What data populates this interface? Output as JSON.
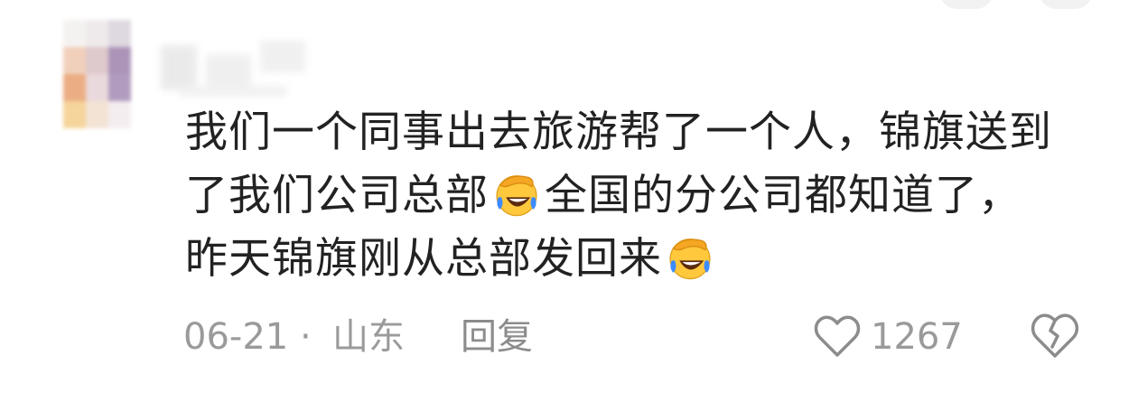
{
  "comment": {
    "line1": "我们一个同事出去旅游帮了一个人，锦旗送到",
    "line2_a": "了我们公司总部",
    "line2_b": "全国的分公司都知道了，",
    "line3_a": "昨天锦旗刚从总部发回来",
    "emoji_1": "facepalm-laugh-emoji",
    "emoji_2": "facepalm-laugh-emoji"
  },
  "meta": {
    "date": "06-21",
    "separator": "·",
    "location": "山东",
    "reply_label": "回复"
  },
  "actions": {
    "like_count": "1267",
    "like_icon": "heart-outline-icon",
    "dislike_icon": "broken-heart-icon"
  },
  "colors": {
    "text": "#222222",
    "meta": "#9a9a9a",
    "emoji_face": "#FFC83D",
    "emoji_tear": "#3D8BFF"
  }
}
